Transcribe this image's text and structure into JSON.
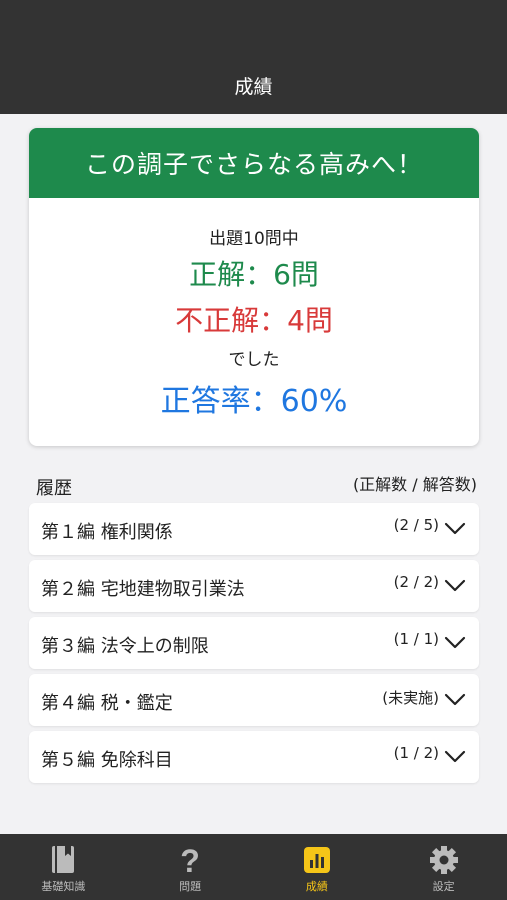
{
  "header": {
    "title": "成績"
  },
  "result": {
    "banner": "この調子でさらなる高みへ！",
    "total": "出題10問中",
    "correct": "正解：6問",
    "incorrect": "不正解：4問",
    "deshita": "でした",
    "rate": "正答率：60%"
  },
  "history": {
    "label": "履歴",
    "sub_label": "(正解数 / 解答数)",
    "items": [
      {
        "title": "第１編 権利関係",
        "score": "(2 / 5)"
      },
      {
        "title": "第２編 宅地建物取引業法",
        "score": "(2 / 2)"
      },
      {
        "title": "第３編 法令上の制限",
        "score": "(1 / 1)"
      },
      {
        "title": "第４編 税・鑑定",
        "score": "(未実施)"
      },
      {
        "title": "第５編 免除科目",
        "score": "(1 / 2)"
      }
    ]
  },
  "tabs": [
    {
      "label": "基礎知識",
      "icon": "book-icon"
    },
    {
      "label": "問題",
      "icon": "question-icon"
    },
    {
      "label": "成績",
      "icon": "chart-icon"
    },
    {
      "label": "設定",
      "icon": "gear-icon"
    }
  ],
  "colors": {
    "header_bg": "#333333",
    "banner_green": "#1e8a4c",
    "correct_green": "#1e8a4c",
    "incorrect_red": "#d83a3a",
    "rate_blue": "#1f77e0",
    "active_tab": "#f5c518"
  }
}
